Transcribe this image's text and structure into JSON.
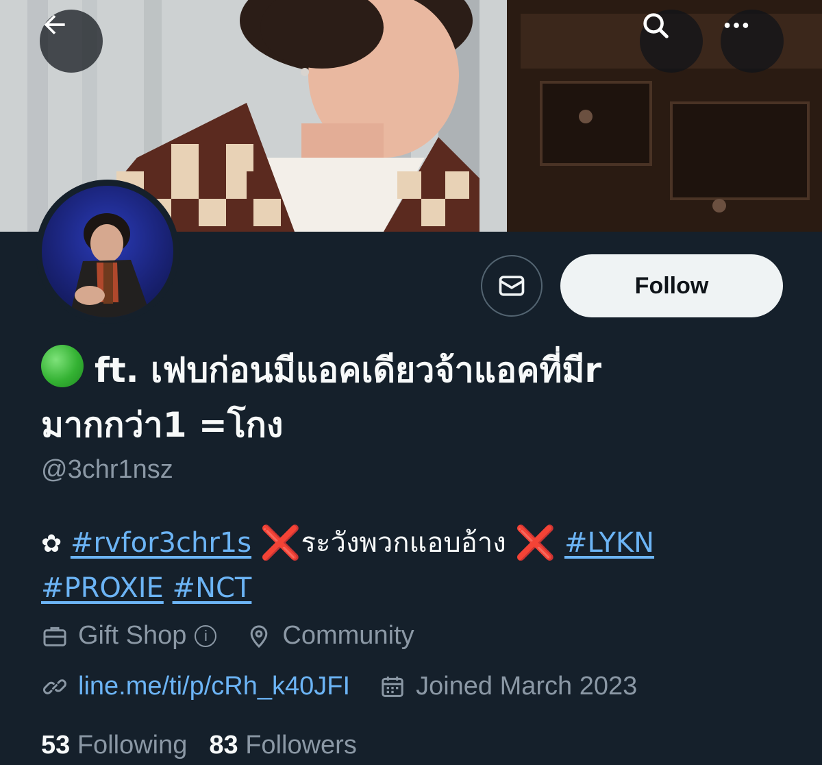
{
  "header": {
    "back_icon": "arrow-left-icon",
    "search_icon": "search-icon",
    "more_icon": "more-horizontal-icon"
  },
  "actions": {
    "message_icon": "envelope-icon",
    "follow_label": "Follow"
  },
  "profile": {
    "status_icon": "green-circle-emoji",
    "name_line1": "ft. เฟบก่อนมีแอคเดียวจ้าแอคที่มีr",
    "name_line2": "มากกว่า1 =โกง",
    "handle": "@3chr1nsz"
  },
  "bio": {
    "flower": "✿",
    "tag1": "#rvfor3chr1s",
    "x_mark": "❌",
    "warning_text": "ระวังพวกแอบอ้าง",
    "tag2": "#LYKN",
    "tag3": "#PROXIE",
    "tag4": "#NCT"
  },
  "meta": {
    "category": "Gift Shop",
    "info_glyph": "i",
    "location": "Community",
    "link": "line.me/ti/p/cRh_k40JFI",
    "joined": "Joined March 2023"
  },
  "stats": {
    "following_count": "53",
    "following_label": "Following",
    "followers_count": "83",
    "followers_label": "Followers"
  },
  "colors": {
    "background": "#15202b",
    "link": "#6cb4f5",
    "muted": "#8b98a5",
    "follow_bg": "#eff3f4"
  }
}
